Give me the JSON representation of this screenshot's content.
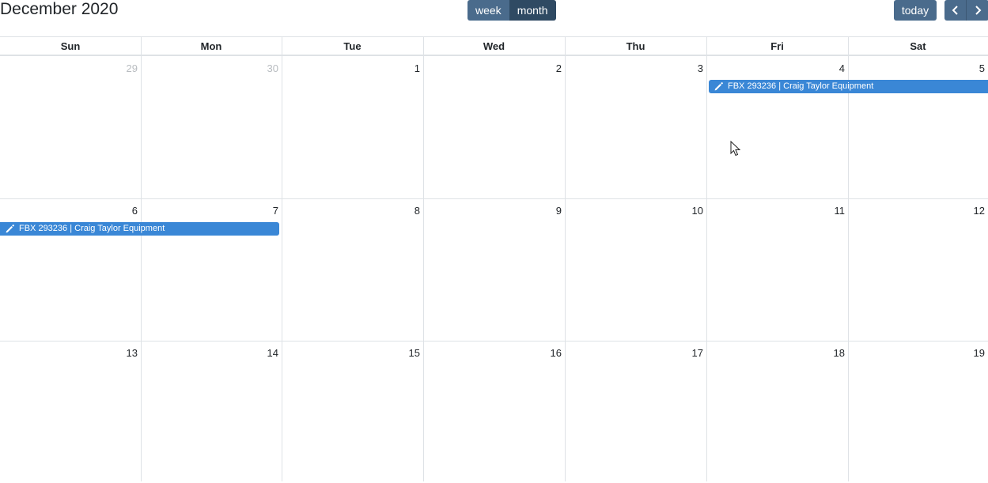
{
  "toolbar": {
    "title": "December 2020",
    "view_week": "week",
    "view_month": "month",
    "today": "today",
    "prev_icon": "chevron-left-icon",
    "next_icon": "chevron-right-icon"
  },
  "weekdays": [
    "Sun",
    "Mon",
    "Tue",
    "Wed",
    "Thu",
    "Fri",
    "Sat"
  ],
  "weeks": [
    [
      {
        "day": "29",
        "other": true
      },
      {
        "day": "30",
        "other": true
      },
      {
        "day": "1",
        "other": false
      },
      {
        "day": "2",
        "other": false
      },
      {
        "day": "3",
        "other": false
      },
      {
        "day": "4",
        "other": false
      },
      {
        "day": "5",
        "other": false
      }
    ],
    [
      {
        "day": "6",
        "other": false
      },
      {
        "day": "7",
        "other": false
      },
      {
        "day": "8",
        "other": false
      },
      {
        "day": "9",
        "other": false
      },
      {
        "day": "10",
        "other": false
      },
      {
        "day": "11",
        "other": false
      },
      {
        "day": "12",
        "other": false
      }
    ],
    [
      {
        "day": "13",
        "other": false
      },
      {
        "day": "14",
        "other": false
      },
      {
        "day": "15",
        "other": false
      },
      {
        "day": "16",
        "other": false
      },
      {
        "day": "17",
        "other": false
      },
      {
        "day": "18",
        "other": false
      },
      {
        "day": "19",
        "other": false
      }
    ]
  ],
  "events": [
    {
      "label": "FBX 293236 | Craig Taylor Equipment",
      "icon": "pencil-icon",
      "start_day": "4",
      "end_day": "5"
    },
    {
      "label": "FBX 293236 | Craig Taylor Equipment",
      "icon": "pencil-icon",
      "start_day": "6",
      "end_day": "7"
    }
  ],
  "colors": {
    "button": "#4a6b8c",
    "button_active": "#2f4a63",
    "event": "#3a87d6",
    "grid": "#dee2e6",
    "other_month_text": "#b8bcc0"
  }
}
